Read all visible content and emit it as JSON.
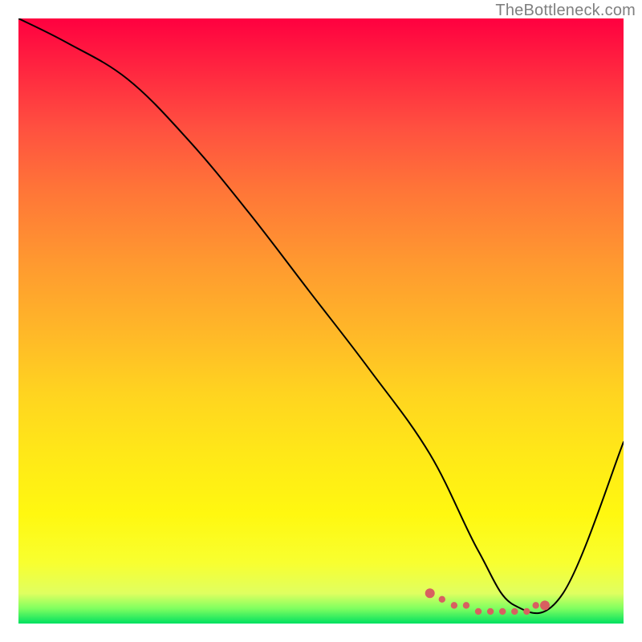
{
  "watermark": "TheBottleneck.com",
  "chart_data": {
    "type": "line",
    "title": "",
    "xlabel": "",
    "ylabel": "",
    "xlim": [
      0,
      100
    ],
    "ylim": [
      0,
      100
    ],
    "series": [
      {
        "name": "bottleneck-curve",
        "x": [
          0,
          8,
          18,
          28,
          38,
          48,
          58,
          68,
          76,
          82,
          90,
          100
        ],
        "values": [
          100,
          96,
          90,
          80,
          68,
          55,
          42,
          28,
          12,
          3,
          5,
          30
        ]
      }
    ],
    "markers": {
      "name": "optimal-zone-dots",
      "x": [
        68,
        70,
        72,
        74,
        76,
        78,
        80,
        82,
        84,
        85.5,
        87
      ],
      "values": [
        5,
        4,
        3,
        3,
        2,
        2,
        2,
        2,
        2,
        3,
        3
      ]
    },
    "gradient_stops": [
      {
        "pos": 0.0,
        "color": "#ff0040"
      },
      {
        "pos": 0.08,
        "color": "#ff2440"
      },
      {
        "pos": 0.18,
        "color": "#ff5040"
      },
      {
        "pos": 0.28,
        "color": "#ff7438"
      },
      {
        "pos": 0.4,
        "color": "#ff9830"
      },
      {
        "pos": 0.52,
        "color": "#ffb828"
      },
      {
        "pos": 0.62,
        "color": "#ffd420"
      },
      {
        "pos": 0.72,
        "color": "#ffe818"
      },
      {
        "pos": 0.82,
        "color": "#fff810"
      },
      {
        "pos": 0.9,
        "color": "#f8ff30"
      },
      {
        "pos": 0.95,
        "color": "#e0ff60"
      },
      {
        "pos": 0.975,
        "color": "#80ff60"
      },
      {
        "pos": 1.0,
        "color": "#00e060"
      }
    ]
  }
}
